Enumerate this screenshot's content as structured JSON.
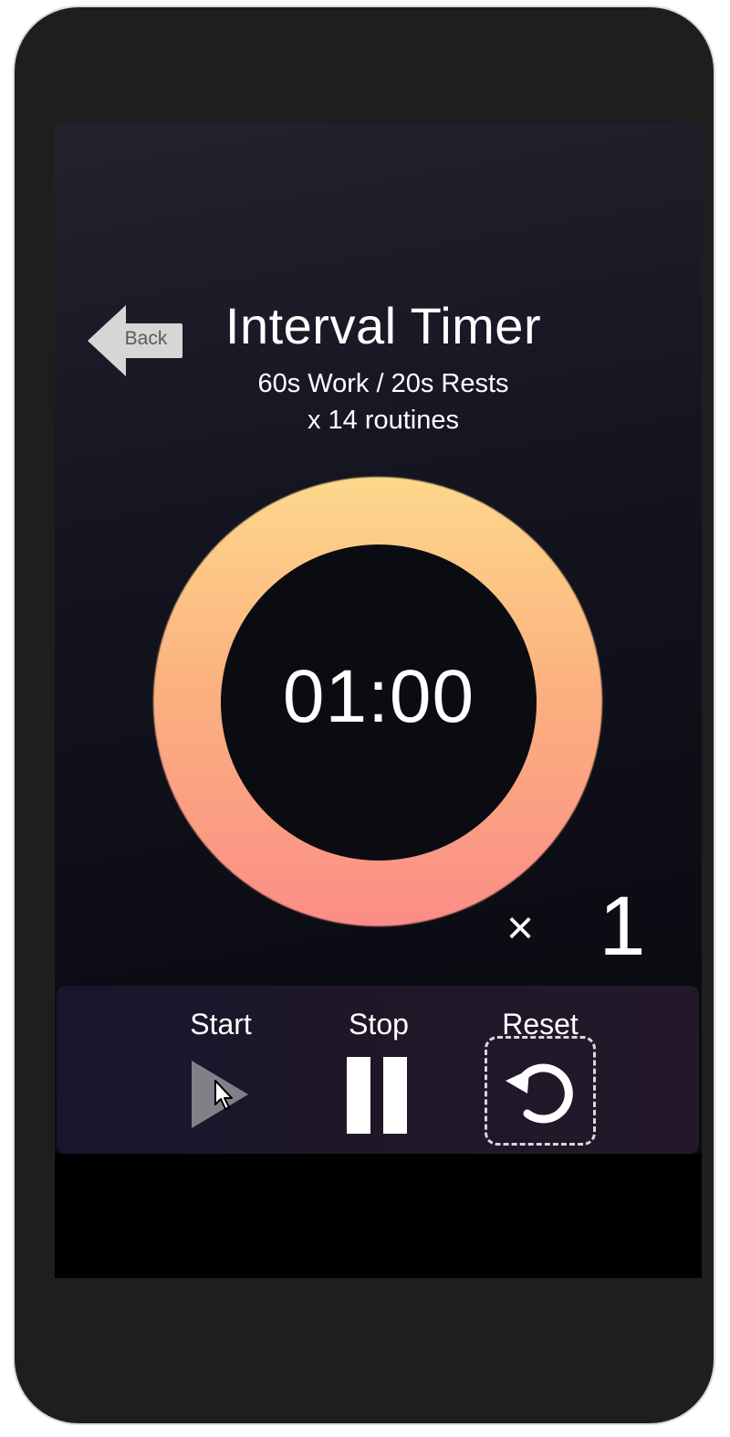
{
  "header": {
    "back_label": "Back",
    "title": "Interval Timer",
    "subtitle_line1": "60s Work / 20s Rests",
    "subtitle_line2": "x 14 routines"
  },
  "timer": {
    "display": "01:00",
    "ring_colors": {
      "top": "#fcd88c",
      "middle": "#fbb27e",
      "bottom": "#fb8d86"
    }
  },
  "multiplier": {
    "symbol": "×",
    "value": "1"
  },
  "controls": {
    "start_label": "Start",
    "stop_label": "Stop",
    "reset_label": "Reset",
    "start_icon": "play-icon",
    "stop_icon": "pause-icon",
    "reset_icon": "reset-icon"
  },
  "colors": {
    "background": "#0c0c14",
    "text": "#ffffff",
    "back_button": "#d6d6d6"
  }
}
